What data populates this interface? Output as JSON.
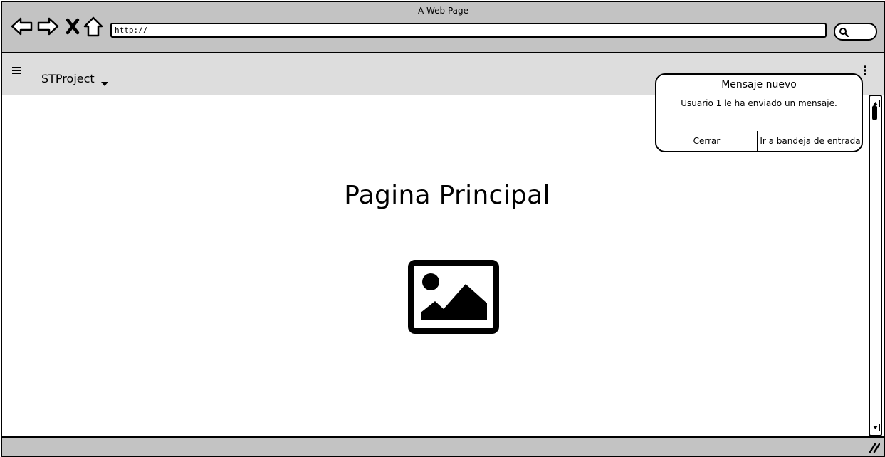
{
  "window": {
    "title": "A Web Page",
    "url": "http://"
  },
  "header": {
    "project": "STProject"
  },
  "main": {
    "title": "Pagina Principal"
  },
  "notification": {
    "title": "Mensaje nuevo",
    "message": "Usuario 1 le ha enviado un mensaje.",
    "close_label": "Cerrar",
    "inbox_label": "Ir a bandeja de entrada"
  },
  "icons": {
    "back": "back-arrow-icon",
    "forward": "forward-arrow-icon",
    "stop": "close-icon",
    "home": "home-icon",
    "search": "search-icon",
    "menu": "hamburger-menu-icon",
    "dropdown": "caret-down-icon",
    "more": "kebab-menu-icon",
    "image": "image-placeholder-icon",
    "resize": "resize-grip-icon"
  },
  "colors": {
    "chrome": "#c3c3c3",
    "header": "#dddddd",
    "ink": "#000000",
    "background": "#ffffff"
  }
}
